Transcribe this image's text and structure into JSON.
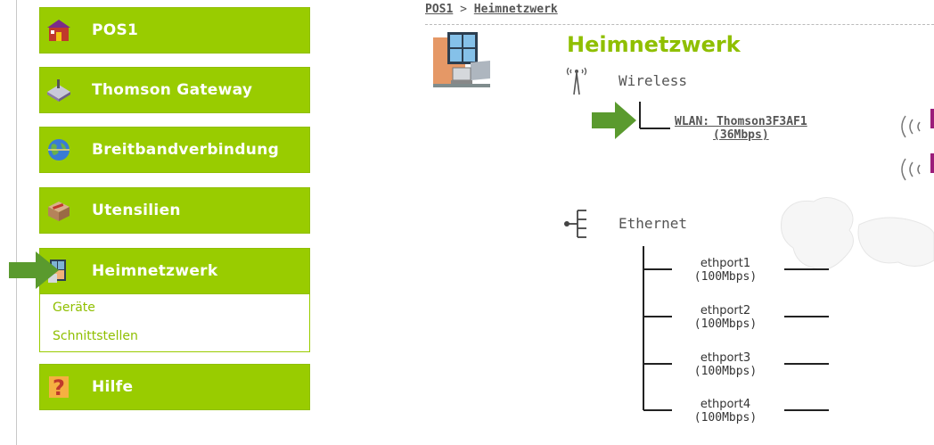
{
  "sidebar": {
    "items": [
      {
        "label": "POS1",
        "icon": "house-icon"
      },
      {
        "label": "Thomson Gateway",
        "icon": "gateway-icon"
      },
      {
        "label": "Breitbandverbindung",
        "icon": "globe-icon"
      },
      {
        "label": "Utensilien",
        "icon": "toolbox-icon"
      },
      {
        "label": "Heimnetzwerk",
        "icon": "home-network-icon"
      },
      {
        "label": "Hilfe",
        "icon": "help-icon"
      }
    ],
    "subitems": [
      {
        "label": "Geräte"
      },
      {
        "label": "Schnittstellen"
      }
    ]
  },
  "breadcrumb": {
    "home": "POS1",
    "separator": ">",
    "current": "Heimnetzwerk"
  },
  "page": {
    "title": "Heimnetzwerk"
  },
  "wireless": {
    "label": "Wireless",
    "interface_name": "WLAN: Thomson3F3AF1",
    "interface_speed": "(36Mbps)"
  },
  "ethernet": {
    "label": "Ethernet",
    "ports": [
      {
        "name": "ethport1",
        "speed": "(100Mbps)"
      },
      {
        "name": "ethport2",
        "speed": "(100Mbps)"
      },
      {
        "name": "ethport3",
        "speed": "(100Mbps)"
      },
      {
        "name": "ethport4",
        "speed": "(100Mbps)"
      }
    ]
  },
  "colors": {
    "accent": "#99cc00",
    "arrow": "#5a9a2e",
    "text": "#555555"
  }
}
